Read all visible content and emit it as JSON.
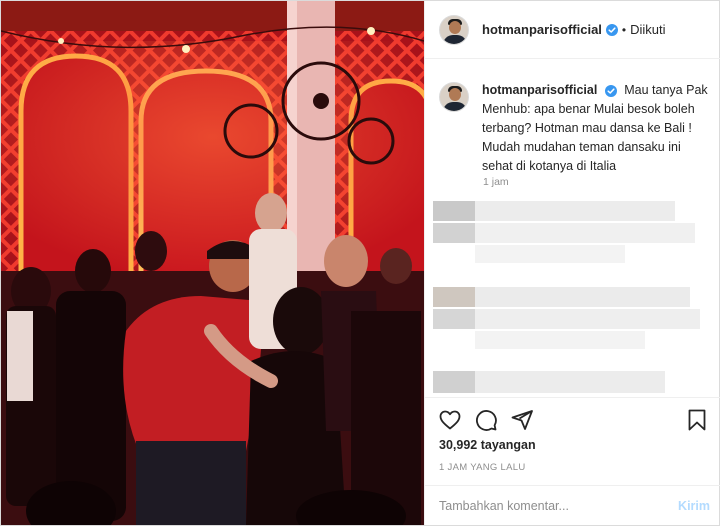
{
  "post": {
    "username": "hotmanparisofficial",
    "follow_status": "Diikuti",
    "dot": "•",
    "caption": "Mau tanya Pak Menhub: apa benar Mulai besok boleh terbang? Hotman mau dansa ke Bali ! Mudah mudahan teman dansaku ini sehat di kotanya di Italia",
    "caption_time": "1 jam",
    "views": "30,992 tayangan",
    "posted_ago": "1 JAM YANG LALU"
  },
  "comment": {
    "placeholder": "Tambahkan komentar...",
    "post_label": "Kirim"
  },
  "icons": {
    "like": "heart-icon",
    "comment": "comment-icon",
    "share": "share-icon",
    "save": "bookmark-icon",
    "verified": "verified-badge-icon"
  },
  "colors": {
    "verified": "#3897f0",
    "post_button": "#b3dbff",
    "muted_text": "#8e8e8e"
  }
}
